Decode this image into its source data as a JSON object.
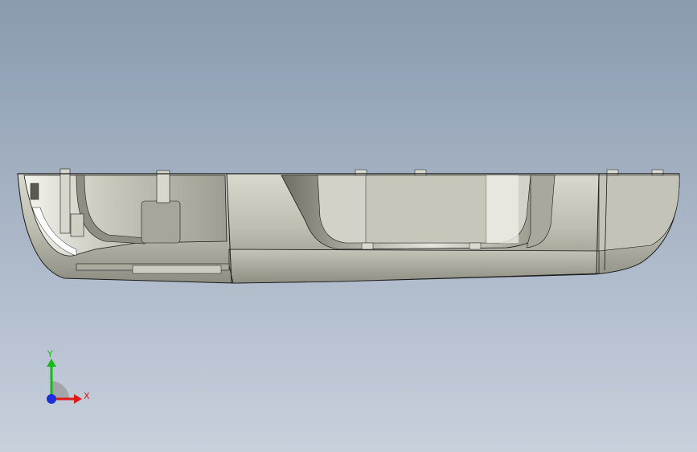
{
  "viewport": {
    "background_top": "#8a9bb0",
    "background_bottom": "#c8d0dc"
  },
  "model": {
    "body_color": "#b9b9ac",
    "shadow_color": "#7f7f73",
    "highlight_color": "#f2f2ec",
    "edge_color": "#1a1a1a"
  },
  "triad": {
    "x_label": "X",
    "y_label": "Y",
    "x_color": "#e01818",
    "y_color": "#18b818",
    "z_color": "#1c2fd8"
  }
}
